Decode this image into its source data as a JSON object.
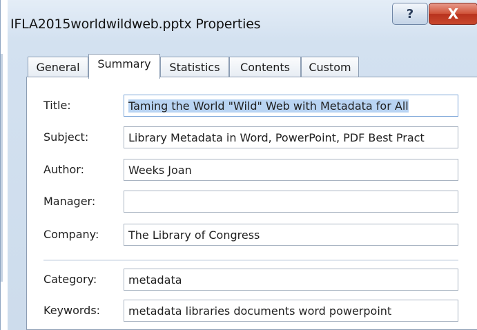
{
  "window": {
    "title": "IFLA2015worldwildweb.pptx Properties",
    "help_glyph": "?",
    "close_glyph": "X"
  },
  "tabs": [
    {
      "label": "General",
      "active": false
    },
    {
      "label": "Summary",
      "active": true
    },
    {
      "label": "Statistics",
      "active": false
    },
    {
      "label": "Contents",
      "active": false
    },
    {
      "label": "Custom",
      "active": false
    }
  ],
  "summary": {
    "title": {
      "label": "Title:",
      "value": "Taming the World \"Wild\" Web with Metadata for All"
    },
    "subject": {
      "label": "Subject:",
      "value": "Library Metadata in Word, PowerPoint, PDF Best Pract"
    },
    "author": {
      "label": "Author:",
      "value": "Weeks Joan"
    },
    "manager": {
      "label": "Manager:",
      "value": ""
    },
    "company": {
      "label": "Company:",
      "value": "The Library of Congress"
    },
    "category": {
      "label": "Category:",
      "value": "metadata"
    },
    "keywords": {
      "label": "Keywords:",
      "value": "metadata libraries documents word powerpoint"
    }
  },
  "colors": {
    "selection": "#b9d4f3",
    "close_button": "#c8472c",
    "window_frame": "#d3e1f0"
  }
}
